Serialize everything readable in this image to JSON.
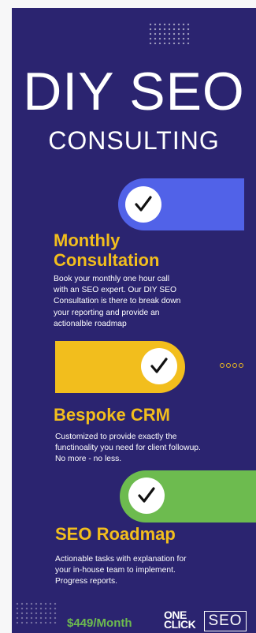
{
  "title": "DIY SEO",
  "subtitle": "CONSULTING",
  "sections": [
    {
      "heading_lines": [
        "Monthly",
        "Consultation"
      ],
      "body_lines": [
        "Book your monthly one hour call",
        "with an SEO expert.  Our DIY SEO",
        "Consultation is there to break down",
        "your reporting and provide an",
        "actionalble roadmap"
      ]
    },
    {
      "heading_lines": [
        "Bespoke CRM"
      ],
      "body_lines": [
        "Customized to provide exactly the",
        "functinoality you need for client followup.",
        "No more - no less."
      ]
    },
    {
      "heading_lines": [
        "SEO Roadmap"
      ],
      "body_lines": [
        "Actionable tasks with explanation for",
        "your in-house team to implement.",
        "Progress reports."
      ]
    }
  ],
  "price": "$449/Month",
  "logo": {
    "one": "ONE",
    "click": "CLICK",
    "seo": "SEO"
  },
  "icons": [
    "check-icon",
    "check-icon",
    "check-icon"
  ],
  "colors": {
    "background": "#2b2470",
    "accent_yellow": "#f2be1d",
    "blue": "#5162e8",
    "green": "#6dbb4f",
    "text": "#ffffff"
  }
}
